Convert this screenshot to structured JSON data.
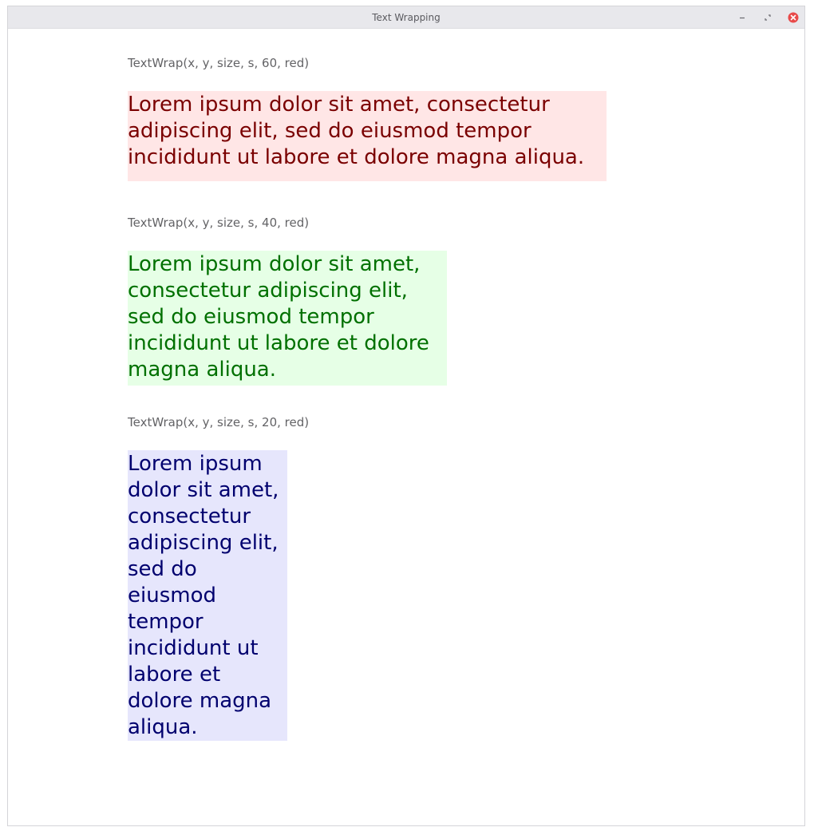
{
  "window": {
    "title": "Text Wrapping",
    "buttons": {
      "minimize": "minimize-icon",
      "maximize": "maximize-icon",
      "close": "close-icon"
    }
  },
  "colors": {
    "red_text": "#7a0000",
    "red_bg": "#ffe6e6",
    "green_text": "#007000",
    "green_bg": "#e6ffe6",
    "blue_text": "#00006e",
    "blue_bg": "#e6e6fc",
    "close_button": "#e84a4a"
  },
  "examples": [
    {
      "caption": "TextWrap(x, y, size, s, 60, red)",
      "lines": [
        "Lorem ipsum dolor sit amet, consectetur",
        "adipiscing elit, sed do eiusmod tempor",
        "incididunt ut labore et dolore magna aliqua."
      ]
    },
    {
      "caption": "TextWrap(x, y, size, s, 40, red)",
      "lines": [
        "Lorem ipsum dolor sit amet,",
        "consectetur adipiscing elit,",
        "sed do eiusmod tempor",
        "incididunt ut labore et dolore",
        "magna aliqua."
      ]
    },
    {
      "caption": "TextWrap(x, y, size, s, 20, red)",
      "lines": [
        "Lorem ipsum",
        "dolor sit amet,",
        "consectetur",
        "adipiscing elit,",
        "sed do",
        "eiusmod",
        "tempor",
        "incididunt ut",
        "labore et",
        "dolore magna",
        "aliqua."
      ]
    }
  ]
}
